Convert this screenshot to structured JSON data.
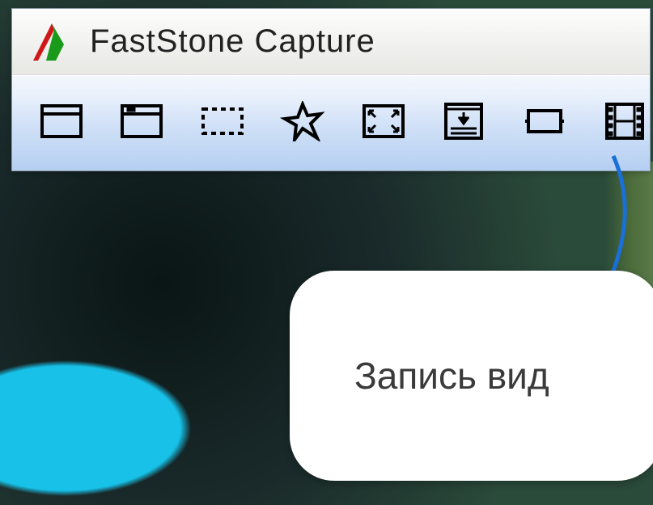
{
  "app": {
    "title": "FastStone Capture"
  },
  "toolbar": {
    "items": [
      {
        "name": "capture-active-window"
      },
      {
        "name": "capture-window-object"
      },
      {
        "name": "capture-rectangle-region"
      },
      {
        "name": "capture-freehand-region"
      },
      {
        "name": "capture-full-screen"
      },
      {
        "name": "capture-scrolling-window"
      },
      {
        "name": "capture-fixed-region"
      },
      {
        "name": "screen-recorder"
      }
    ]
  },
  "callout": {
    "text": "Запись вид"
  }
}
